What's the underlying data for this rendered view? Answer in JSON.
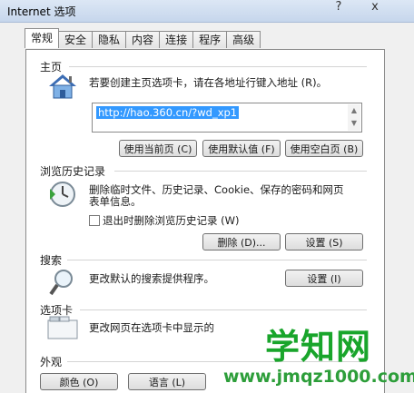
{
  "title": "Internet 选项",
  "title_buttons": {
    "help": "?",
    "close": "x"
  },
  "tabs": [
    "常规",
    "安全",
    "隐私",
    "内容",
    "连接",
    "程序",
    "高级"
  ],
  "home": {
    "group": "主页",
    "hint": "若要创建主页选项卡，请在各地址行键入地址 (R)。",
    "url": "http://hao.360.cn/?wd_xp1",
    "btn_current": "使用当前页 (C)",
    "btn_default": "使用默认值 (F)",
    "btn_blank": "使用空白页 (B)"
  },
  "history": {
    "group": "浏览历史记录",
    "desc1": "删除临时文件、历史记录、Cookie、保存的密码和网页",
    "desc2": "表单信息。",
    "checkbox": "退出时删除浏览历史记录 (W)",
    "btn_delete": "删除 (D)...",
    "btn_settings": "设置 (S)"
  },
  "search": {
    "group": "搜索",
    "desc": "更改默认的搜索提供程序。",
    "btn_settings": "设置 (I)"
  },
  "tabs_group": {
    "group": "选项卡",
    "desc": "更改网页在选项卡中显示的"
  },
  "appearance": {
    "group": "外观",
    "btn_colors": "颜色 (O)",
    "btn_language": "语言 (L)"
  },
  "watermark": {
    "brand": "学知网",
    "url": "www.jmqz1000.com"
  },
  "colors": {
    "selection": "#3399ff",
    "watermark_green": "#19a52b",
    "watermark_url": "#2d9e3a"
  },
  "icons": [
    "home-icon",
    "history-icon",
    "search-icon",
    "tabs-icon"
  ]
}
